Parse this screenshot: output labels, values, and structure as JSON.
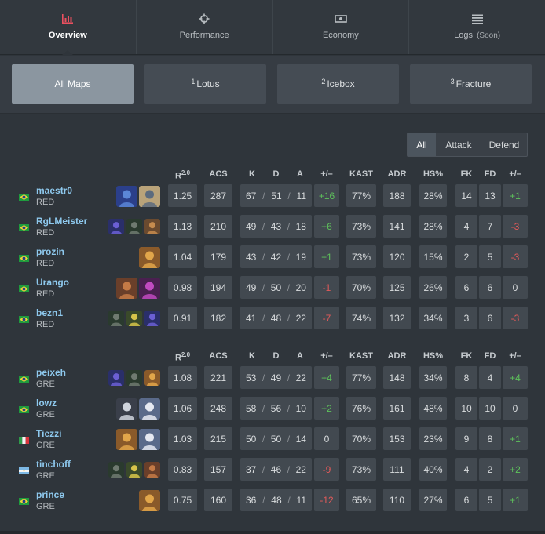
{
  "nav": {
    "tabs": [
      {
        "label": "Overview",
        "icon": "bar-chart-icon",
        "active": true
      },
      {
        "label": "Performance",
        "icon": "crosshair-icon",
        "active": false
      },
      {
        "label": "Economy",
        "icon": "banknote-icon",
        "active": false
      },
      {
        "label": "Logs",
        "soon": "(Soon)",
        "icon": "list-icon",
        "active": false
      }
    ]
  },
  "maps": [
    {
      "num": "",
      "label": "All Maps",
      "active": true
    },
    {
      "num": "1",
      "label": "Lotus",
      "active": false
    },
    {
      "num": "2",
      "label": "Icebox",
      "active": false
    },
    {
      "num": "3",
      "label": "Fracture",
      "active": false
    }
  ],
  "side_filter": [
    "All",
    "Attack",
    "Defend"
  ],
  "columns": {
    "rating": "R",
    "rating_sup": "2.0",
    "acs": "ACS",
    "k": "K",
    "d": "D",
    "a": "A",
    "pm": "+/–",
    "kast": "KAST",
    "adr": "ADR",
    "hs": "HS%",
    "fk": "FK",
    "fd": "FD",
    "fkpm": "+/–"
  },
  "teams": [
    {
      "players": [
        {
          "name": "maestr0",
          "team": "RED",
          "flag": "brazil-flag-icon",
          "agents": [
            "agent-neon-icon",
            "agent-sova-icon"
          ],
          "rating": "1.25",
          "acs": "287",
          "k": "67",
          "d": "51",
          "a": "11",
          "pm": "+16",
          "kast": "77%",
          "adr": "188",
          "hs": "28%",
          "fk": "14",
          "fd": "13",
          "fkpm": "+1"
        },
        {
          "name": "RgLMeister",
          "team": "RED",
          "flag": "brazil-flag-icon",
          "agents": [
            "agent-omen-icon",
            "agent-viper-icon",
            "agent-kayo-icon"
          ],
          "rating": "1.13",
          "acs": "210",
          "k": "49",
          "d": "43",
          "a": "18",
          "pm": "+6",
          "kast": "73%",
          "adr": "141",
          "hs": "28%",
          "fk": "4",
          "fd": "7",
          "fkpm": "-3"
        },
        {
          "name": "prozin",
          "team": "RED",
          "flag": "brazil-flag-icon",
          "agents": [
            "agent-raze-icon"
          ],
          "rating": "1.04",
          "acs": "179",
          "k": "43",
          "d": "42",
          "a": "19",
          "pm": "+1",
          "kast": "73%",
          "adr": "120",
          "hs": "15%",
          "fk": "2",
          "fd": "5",
          "fkpm": "-3"
        },
        {
          "name": "Urango",
          "team": "RED",
          "flag": "brazil-flag-icon",
          "agents": [
            "agent-breach-icon",
            "agent-reyna-icon"
          ],
          "rating": "0.98",
          "acs": "194",
          "k": "49",
          "d": "50",
          "a": "20",
          "pm": "-1",
          "kast": "70%",
          "adr": "125",
          "hs": "26%",
          "fk": "6",
          "fd": "6",
          "fkpm": "0"
        },
        {
          "name": "bezn1",
          "team": "RED",
          "flag": "brazil-flag-icon",
          "agents": [
            "agent-viper-icon",
            "agent-killjoy-icon",
            "agent-omen-icon"
          ],
          "rating": "0.91",
          "acs": "182",
          "k": "41",
          "d": "48",
          "a": "22",
          "pm": "-7",
          "kast": "74%",
          "adr": "132",
          "hs": "34%",
          "fk": "3",
          "fd": "6",
          "fkpm": "-3"
        }
      ]
    },
    {
      "players": [
        {
          "name": "peixeh",
          "team": "GRE",
          "flag": "brazil-flag-icon",
          "agents": [
            "agent-omen-icon",
            "agent-viper-icon",
            "agent-raze-icon"
          ],
          "rating": "1.08",
          "acs": "221",
          "k": "53",
          "d": "49",
          "a": "22",
          "pm": "+4",
          "kast": "77%",
          "adr": "148",
          "hs": "34%",
          "fk": "8",
          "fd": "4",
          "fkpm": "+4"
        },
        {
          "name": "lowz",
          "team": "GRE",
          "flag": "brazil-flag-icon",
          "agents": [
            "agent-jett-icon",
            "agent-yoru-icon"
          ],
          "rating": "1.06",
          "acs": "248",
          "k": "58",
          "d": "56",
          "a": "10",
          "pm": "+2",
          "kast": "76%",
          "adr": "161",
          "hs": "48%",
          "fk": "10",
          "fd": "10",
          "fkpm": "0"
        },
        {
          "name": "Tiezzi",
          "team": "GRE",
          "flag": "italy-flag-icon",
          "agents": [
            "agent-raze-icon",
            "agent-yoru-icon"
          ],
          "rating": "1.03",
          "acs": "215",
          "k": "50",
          "d": "50",
          "a": "14",
          "pm": "0",
          "kast": "70%",
          "adr": "153",
          "hs": "23%",
          "fk": "9",
          "fd": "8",
          "fkpm": "+1"
        },
        {
          "name": "tinchoff",
          "team": "GRE",
          "flag": "argentina-flag-icon",
          "agents": [
            "agent-viper-icon",
            "agent-killjoy-icon",
            "agent-breach-icon"
          ],
          "rating": "0.83",
          "acs": "157",
          "k": "37",
          "d": "46",
          "a": "22",
          "pm": "-9",
          "kast": "73%",
          "adr": "111",
          "hs": "40%",
          "fk": "4",
          "fd": "2",
          "fkpm": "+2"
        },
        {
          "name": "prince",
          "team": "GRE",
          "flag": "brazil-flag-icon",
          "agents": [
            "agent-raze-icon"
          ],
          "rating": "0.75",
          "acs": "160",
          "k": "36",
          "d": "48",
          "a": "11",
          "pm": "-12",
          "kast": "65%",
          "adr": "110",
          "hs": "27%",
          "fk": "6",
          "fd": "5",
          "fkpm": "+1"
        }
      ]
    }
  ],
  "colors": {
    "accent": "#e9505f",
    "link": "#8ec9ee",
    "positive": "#5ec15b",
    "negative": "#e05a5a",
    "active_map": "#8b96a0"
  }
}
